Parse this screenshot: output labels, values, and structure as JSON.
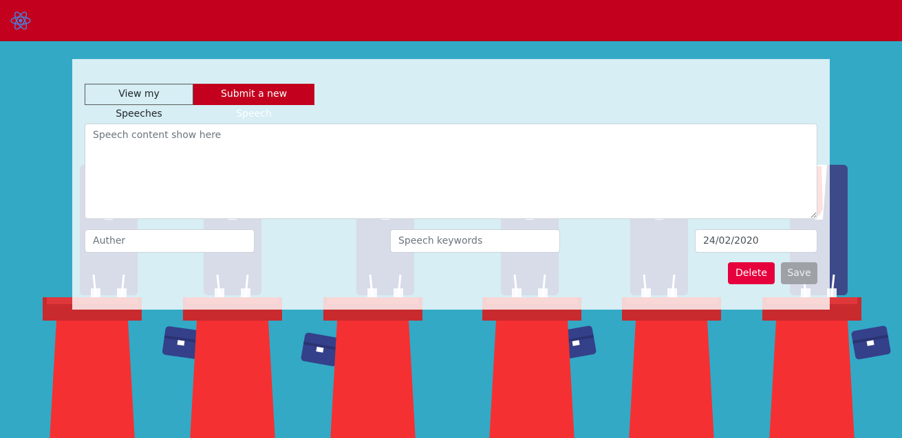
{
  "navbar": {
    "logo_icon": "react-atom-icon",
    "color": "#c3001d"
  },
  "tabs": [
    {
      "label": "View my Speeches",
      "active": false
    },
    {
      "label": "Submit a new Speech",
      "active": true
    }
  ],
  "form": {
    "content_placeholder": "Speech content show here",
    "author_placeholder": "Auther",
    "keywords_placeholder": "Speech keywords",
    "date_value": "24/02/2020"
  },
  "buttons": {
    "delete_label": "Delete",
    "save_label": "Save"
  },
  "colors": {
    "accent": "#c3001d",
    "background": "#33a9c5",
    "danger": "#e6003c",
    "podium": "#f53032"
  }
}
